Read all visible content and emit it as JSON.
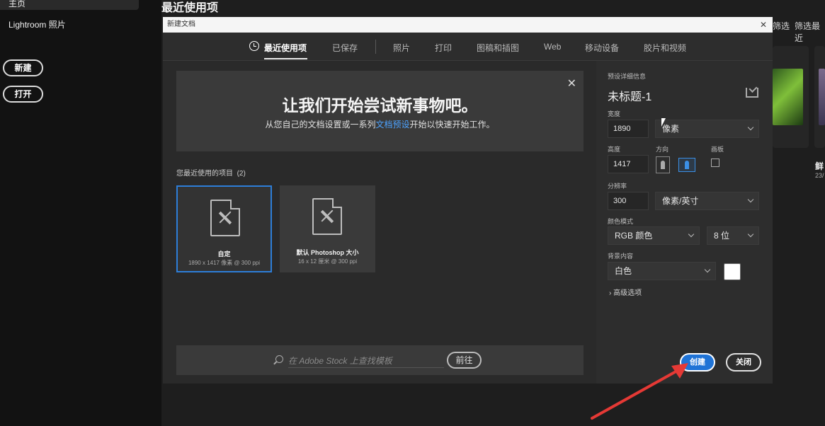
{
  "sidebar": {
    "home": "主页",
    "lightroom": "Lightroom 照片",
    "new_button": "新建",
    "open_button": "打开"
  },
  "main": {
    "title": "最近使用项",
    "filter_label": "筛选",
    "filter_recent": "筛选最近",
    "bg_card_title": "鲜",
    "bg_card_date": "23/"
  },
  "dialog": {
    "title": "新建文档",
    "tabs": [
      {
        "label": "最近使用项",
        "active": true
      },
      {
        "label": "已保存"
      },
      {
        "label": "照片"
      },
      {
        "label": "打印"
      },
      {
        "label": "图稿和插图"
      },
      {
        "label": "Web"
      },
      {
        "label": "移动设备"
      },
      {
        "label": "胶片和视频"
      }
    ],
    "hero": {
      "title": "让我们开始尝试新事物吧。",
      "subtitle_pre": "从您自己的文档设置或一系列",
      "subtitle_link": "文档预设",
      "subtitle_post": "开始以快速开始工作。"
    },
    "recent_label": "您最近使用的项目",
    "recent_count": "(2)",
    "recent_items": [
      {
        "name": "自定",
        "meta": "1890 x 1417 像素 @ 300 ppi",
        "selected": true
      },
      {
        "name": "默认 Photoshop 大小",
        "meta": "16 x 12 厘米 @ 300 ppi",
        "selected": false
      }
    ],
    "stock_placeholder": "在 Adobe Stock 上查找模板",
    "stock_go": "前往",
    "preset": {
      "section_label": "预设详细信息",
      "name": "未标题-1",
      "width_label": "宽度",
      "width_value": "1890",
      "width_unit": "像素",
      "height_label": "高度",
      "height_value": "1417",
      "orientation_label": "方向",
      "artboard_label": "画板",
      "resolution_label": "分辨率",
      "resolution_value": "300",
      "resolution_unit": "像素/英寸",
      "color_mode_label": "颜色模式",
      "color_mode": "RGB 颜色",
      "bit_depth": "8 位",
      "background_label": "背景内容",
      "background": "白色",
      "background_color": "#ffffff",
      "advanced": "高级选项"
    },
    "create_button": "创建",
    "close_button": "关闭"
  },
  "colors": {
    "accent": "#1f73d6",
    "annotation_arrow": "#e53935"
  }
}
